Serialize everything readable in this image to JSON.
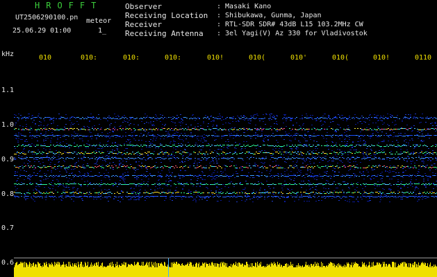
{
  "header": {
    "brand": "HROFFT",
    "filename": "UT2506290100.pn",
    "product": "meteor",
    "datetime": "25.06.29 01:00",
    "flag": "1_",
    "meta": [
      {
        "label": "Observer",
        "value": ": Masaki Kano"
      },
      {
        "label": "Receiving Location",
        "value": ": Shibukawa, Gunma, Japan"
      },
      {
        "label": "Receiver",
        "value": ": RTL-SDR SDR# 43dB L15 103.2MHz CW"
      },
      {
        "label": "Receiving Antenna",
        "value": ": 3el Yagi(V) Az 330 for Vladivostok"
      }
    ]
  },
  "axes": {
    "unit": "kHz",
    "freq_ticks": [
      {
        "label": "1.1",
        "value": 1.1
      },
      {
        "label": "1.0",
        "value": 1.0
      },
      {
        "label": "0.9",
        "value": 0.9
      },
      {
        "label": "0.8",
        "value": 0.8
      },
      {
        "label": "0.7",
        "value": 0.7
      },
      {
        "label": "0.6",
        "value": 0.6
      }
    ],
    "time_ticks": [
      "010",
      "0102",
      "0103",
      "0104",
      "0105",
      "0106",
      "0107",
      "0108",
      "0109",
      "0110"
    ],
    "time_ticks_visible": [
      "010",
      "010:",
      "010:",
      "010:",
      "010!",
      "010(",
      "010'",
      "010(",
      "010!",
      "0110"
    ]
  },
  "colors": {
    "brand": "#3ccf3c",
    "time_axis": "#f0e000",
    "amplitude": "#f0e000",
    "background": "#000000"
  }
}
